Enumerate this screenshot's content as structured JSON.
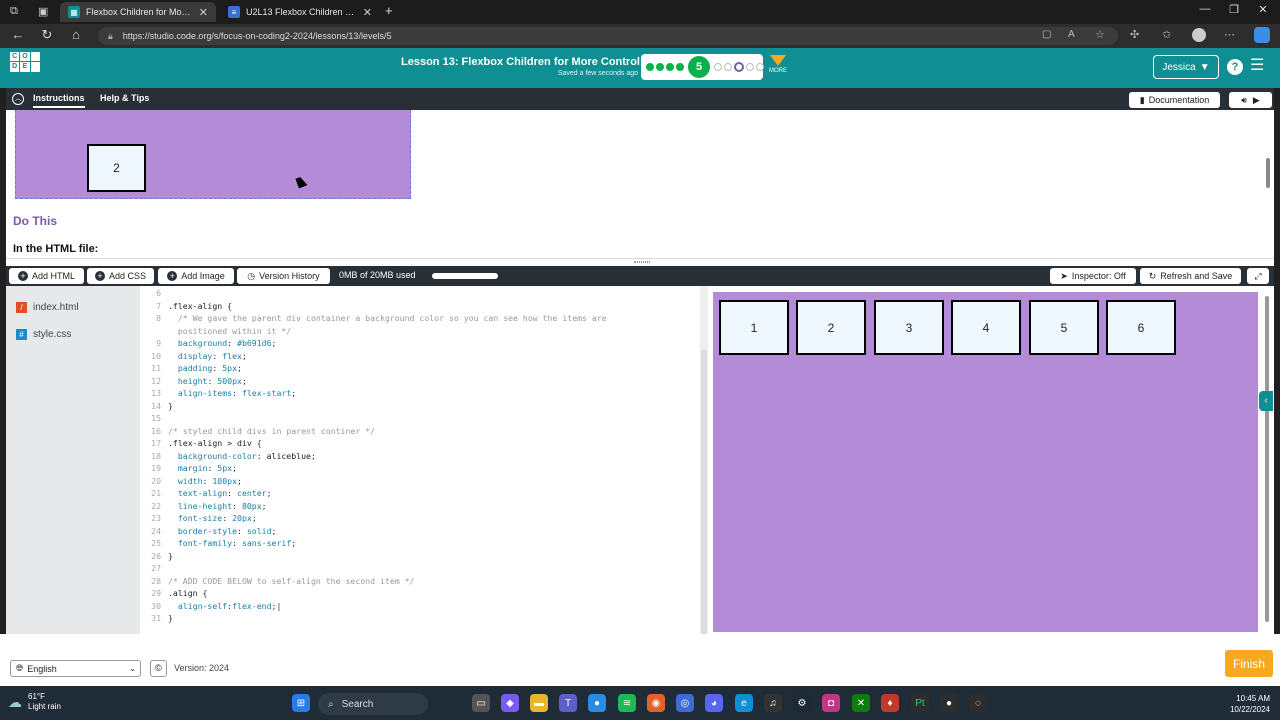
{
  "browser": {
    "tabs": [
      {
        "title": "Flexbox Children for More Contro",
        "active": true
      },
      {
        "title": "U2L13 Flexbox Children Cheat Sh",
        "active": false
      }
    ],
    "new_tab": "+",
    "url": "https://studio.code.org/s/focus-on-coding2-2024/lessons/13/levels/5"
  },
  "header": {
    "logo_letters": [
      "C",
      "O",
      "",
      "D",
      "E",
      ""
    ],
    "lesson_title": "Lesson 13: Flexbox Children for More Control",
    "saved_status": "Saved a few seconds ago",
    "current_level": "5",
    "more_label": "MORE",
    "user": "Jessica",
    "help": "?"
  },
  "instructions": {
    "tab_instructions": "Instructions",
    "tab_help": "Help & Tips",
    "documentation": "Documentation",
    "example_box": "2",
    "do_this": "Do This",
    "in_html": "In the HTML file:"
  },
  "toolbar": {
    "add_html": "Add HTML",
    "add_css": "Add CSS",
    "add_image": "Add Image",
    "version_history": "Version History",
    "storage": "0MB of 20MB used",
    "inspector": "Inspector: Off",
    "refresh_save": "Refresh and Save"
  },
  "files": [
    {
      "name": "index.html",
      "icon": "html-file-icon"
    },
    {
      "name": "style.css",
      "icon": "css-file-icon"
    }
  ],
  "code_lines": [
    {
      "n": "6",
      "segs": [
        [
          "",
          ""
        ]
      ]
    },
    {
      "n": "7",
      "segs": [
        [
          "sel",
          ".flex-align"
        ],
        [
          "",
          " {"
        ]
      ]
    },
    {
      "n": "8",
      "segs": [
        [
          "cm",
          "  /* We gave the parent div container a background color so you can see how the items are"
        ]
      ]
    },
    {
      "n": "",
      "segs": [
        [
          "cm",
          "  positioned within it */"
        ]
      ]
    },
    {
      "n": "9",
      "segs": [
        [
          "prop",
          "  background"
        ],
        [
          "",
          ": "
        ],
        [
          "val",
          "#b691d6"
        ],
        [
          "",
          ";"
        ]
      ]
    },
    {
      "n": "10",
      "segs": [
        [
          "prop",
          "  display"
        ],
        [
          "",
          ": "
        ],
        [
          "val",
          "flex"
        ],
        [
          "",
          ";"
        ]
      ]
    },
    {
      "n": "11",
      "segs": [
        [
          "prop",
          "  padding"
        ],
        [
          "",
          ": "
        ],
        [
          "val",
          "5px"
        ],
        [
          "",
          ";"
        ]
      ]
    },
    {
      "n": "12",
      "segs": [
        [
          "prop",
          "  height"
        ],
        [
          "",
          ": "
        ],
        [
          "val",
          "500px"
        ],
        [
          "",
          ";"
        ]
      ]
    },
    {
      "n": "13",
      "segs": [
        [
          "prop",
          "  align-items"
        ],
        [
          "",
          ": "
        ],
        [
          "val",
          "flex-start"
        ],
        [
          "",
          ";"
        ]
      ]
    },
    {
      "n": "14",
      "segs": [
        [
          "",
          "}"
        ]
      ]
    },
    {
      "n": "15",
      "segs": [
        [
          "",
          ""
        ]
      ]
    },
    {
      "n": "16",
      "segs": [
        [
          "cm",
          "/* styled child divs in parent continer */"
        ]
      ]
    },
    {
      "n": "17",
      "segs": [
        [
          "sel",
          ".flex-align > div"
        ],
        [
          "",
          " {"
        ]
      ]
    },
    {
      "n": "18",
      "segs": [
        [
          "prop",
          "  background-color"
        ],
        [
          "",
          ": "
        ],
        [
          "sel",
          "aliceblue"
        ],
        [
          "",
          ";"
        ]
      ]
    },
    {
      "n": "19",
      "segs": [
        [
          "prop",
          "  margin"
        ],
        [
          "",
          ": "
        ],
        [
          "val",
          "5px"
        ],
        [
          "",
          ";"
        ]
      ]
    },
    {
      "n": "20",
      "segs": [
        [
          "prop",
          "  width"
        ],
        [
          "",
          ": "
        ],
        [
          "val",
          "100px"
        ],
        [
          "",
          ";"
        ]
      ]
    },
    {
      "n": "21",
      "segs": [
        [
          "prop",
          "  text-align"
        ],
        [
          "",
          ": "
        ],
        [
          "val",
          "center"
        ],
        [
          "",
          ";"
        ]
      ]
    },
    {
      "n": "22",
      "segs": [
        [
          "prop",
          "  line-height"
        ],
        [
          "",
          ": "
        ],
        [
          "val",
          "80px"
        ],
        [
          "",
          ";"
        ]
      ]
    },
    {
      "n": "23",
      "segs": [
        [
          "prop",
          "  font-size"
        ],
        [
          "",
          ": "
        ],
        [
          "val",
          "20px"
        ],
        [
          "",
          ";"
        ]
      ]
    },
    {
      "n": "24",
      "segs": [
        [
          "prop",
          "  border-style"
        ],
        [
          "",
          ": "
        ],
        [
          "val",
          "solid"
        ],
        [
          "",
          ";"
        ]
      ]
    },
    {
      "n": "25",
      "segs": [
        [
          "prop",
          "  font-family"
        ],
        [
          "",
          ": "
        ],
        [
          "val",
          "sans-serif"
        ],
        [
          "",
          ";"
        ]
      ]
    },
    {
      "n": "26",
      "segs": [
        [
          "",
          "}"
        ]
      ]
    },
    {
      "n": "27",
      "segs": [
        [
          "",
          ""
        ]
      ]
    },
    {
      "n": "28",
      "segs": [
        [
          "cm",
          "/* ADD CODE BELOW to self-align the second item */"
        ]
      ]
    },
    {
      "n": "29",
      "segs": [
        [
          "sel",
          ".align"
        ],
        [
          "",
          " {"
        ]
      ]
    },
    {
      "n": "30",
      "segs": [
        [
          "prop",
          "  align-self"
        ],
        [
          "",
          ":"
        ],
        [
          "val",
          "flex-end"
        ],
        [
          "",
          ";|"
        ]
      ]
    },
    {
      "n": "31",
      "segs": [
        [
          "",
          "}"
        ]
      ]
    }
  ],
  "preview_boxes": [
    "1",
    "2",
    "3",
    "4",
    "5",
    "6"
  ],
  "footer": {
    "language": "English",
    "copyright": "©",
    "version": "Version: 2024",
    "finish": "Finish"
  },
  "taskbar": {
    "temperature": "61°F",
    "weather": "Light rain",
    "search": "Search",
    "time": "10:45 AM",
    "date": "10/22/2024"
  },
  "colors": {
    "brand": "#0f8f94",
    "preview_bg": "#b38bd6",
    "finish": "#f7a823",
    "level_done": "#0ab04a"
  }
}
